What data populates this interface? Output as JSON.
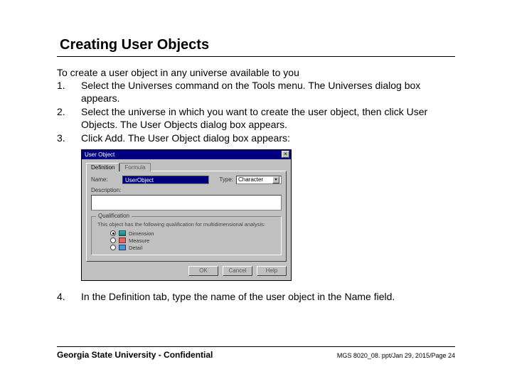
{
  "title": "Creating User Objects",
  "intro": "To create a user object in any universe available to you",
  "steps": [
    {
      "num": "1.",
      "text": "Select the Universes command on the Tools menu.  The Universes dialog box appears."
    },
    {
      "num": "2.",
      "text": "Select the universe in which you want to create the user object, then click User Objects.  The User Objects dialog box appears."
    },
    {
      "num": "3.",
      "text": "Click Add.  The User Object dialog box appears:"
    },
    {
      "num": "4.",
      "text": "In the Definition tab, type the name of the user object in the Name field."
    }
  ],
  "dialog": {
    "title": "User Object",
    "tabs": {
      "active": "Definition",
      "inactive": "Formula"
    },
    "name_label": "Name:",
    "name_value": "UserObject",
    "type_label": "Type:",
    "type_value": "Character",
    "desc_label": "Description:",
    "group_title": "Qualification",
    "group_note": "This object has the following qualification for multidimensional analysis:",
    "radios": {
      "dimension": "Dimension",
      "measure": "Measure",
      "detail": "Detail"
    },
    "buttons": {
      "ok": "OK",
      "cancel": "Cancel",
      "help": "Help"
    }
  },
  "footer": {
    "left": "Georgia State University - Confidential",
    "right": "MGS 8020_08. ppt/Jan 29, 2015/Page 24"
  }
}
